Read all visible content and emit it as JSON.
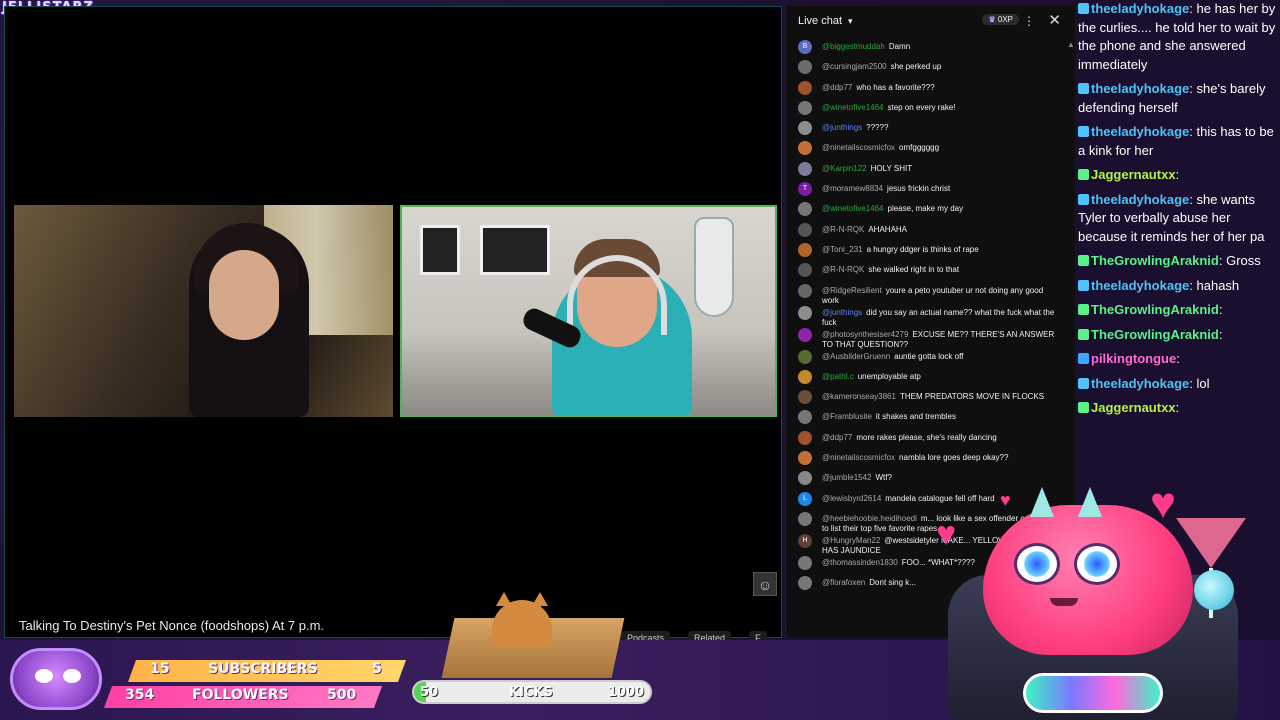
{
  "overlay": {
    "logo": "JELLISTARZ",
    "subscribers": {
      "label": "SUBSCRIBERS",
      "current": "15",
      "goal": "5"
    },
    "followers": {
      "label": "FOLLOWERS",
      "current": "354",
      "goal": "500"
    },
    "kicks": {
      "label": "KICKS",
      "current": "50",
      "goal": "1000",
      "progress": 0.05
    }
  },
  "stream": {
    "title": "Talking To Destiny's Pet Nonce (foodshops) At 7 p.m.",
    "tabs": [
      "Podcasts",
      "Related",
      "F"
    ]
  },
  "live_chat": {
    "header": "Live chat",
    "xp": "0XP",
    "close": "✕",
    "messages": [
      {
        "author": "@biggestmuddah",
        "text": "Damn",
        "avatar_color": "#5c6bc0",
        "avatar_letter": "B",
        "role": "member"
      },
      {
        "author": "@cursingjam2500",
        "text": "she perked up",
        "avatar_color": "#6d6d6d",
        "avatar_letter": "",
        "role": ""
      },
      {
        "author": "@ddp77",
        "text": "who has a favorite???",
        "avatar_color": "#a0522d",
        "avatar_letter": "",
        "role": ""
      },
      {
        "author": "@winetofive1464",
        "text": "step on every rake!",
        "avatar_color": "#777777",
        "avatar_letter": "",
        "role": "member"
      },
      {
        "author": "@junthings",
        "text": "?????",
        "avatar_color": "#8d8d8d",
        "avatar_letter": "",
        "role": "mod"
      },
      {
        "author": "@ninetailscosmicfox",
        "text": "omfgggggg",
        "avatar_color": "#c2703a",
        "avatar_letter": "",
        "role": ""
      },
      {
        "author": "@Karpin122",
        "text": "HOLY SHIT",
        "avatar_color": "#7a7a99",
        "avatar_letter": "",
        "role": "member"
      },
      {
        "author": "@moramew8834",
        "text": "jesus frickin christ",
        "avatar_color": "#7b1fa2",
        "avatar_letter": "T",
        "role": ""
      },
      {
        "author": "@winetofive1464",
        "text": "please, make my day",
        "avatar_color": "#777777",
        "avatar_letter": "",
        "role": "member"
      },
      {
        "author": "@R-N-RQK",
        "text": "AHAHAHA",
        "avatar_color": "#555555",
        "avatar_letter": "",
        "role": ""
      },
      {
        "author": "@Toni_231",
        "text": "a hungry ddger is thinks of rape",
        "avatar_color": "#b0652a",
        "avatar_letter": "",
        "role": ""
      },
      {
        "author": "@R-N-RQK",
        "text": "she walked right in to that",
        "avatar_color": "#555555",
        "avatar_letter": "",
        "role": ""
      },
      {
        "author": "@RidgeResilient",
        "text": "youre a peto youtuber ur not doing any good work",
        "avatar_color": "#666666",
        "avatar_letter": "",
        "role": ""
      },
      {
        "author": "@junthings",
        "text": "did you say an actual name?? what the fuck what the fuck",
        "avatar_color": "#8d8d8d",
        "avatar_letter": "",
        "role": "mod"
      },
      {
        "author": "@photosynthesiser4279",
        "text": "EXCUSE ME?? THERE'S AN ANSWER TO THAT QUESTION??",
        "avatar_color": "#8e24aa",
        "avatar_letter": "",
        "role": ""
      },
      {
        "author": "@AusbilderGruenn",
        "text": "auntie gotta lock off",
        "avatar_color": "#556b2f",
        "avatar_letter": "",
        "role": ""
      },
      {
        "author": "@pathl.c",
        "text": "unemployable atp",
        "avatar_color": "#c48b2a",
        "avatar_letter": "",
        "role": "member"
      },
      {
        "author": "@kameronseay3861",
        "text": "THEM PREDATORS MOVE IN FLOCKS",
        "avatar_color": "#6b4e3a",
        "avatar_letter": "",
        "role": ""
      },
      {
        "author": "@Framblusite",
        "text": "it shakes and trembles",
        "avatar_color": "#777777",
        "avatar_letter": "",
        "role": ""
      },
      {
        "author": "@ddp77",
        "text": "more rakes please, she's really dancing",
        "avatar_color": "#a0522d",
        "avatar_letter": "",
        "role": ""
      },
      {
        "author": "@ninetailscosmicfox",
        "text": "nambla lore goes deep okay??",
        "avatar_color": "#c2703a",
        "avatar_letter": "",
        "role": ""
      },
      {
        "author": "@jumble1542",
        "text": "Wtf?",
        "avatar_color": "#888888",
        "avatar_letter": "",
        "role": ""
      },
      {
        "author": "@lewisbyrd2614",
        "text": "mandela catalogue fell off hard",
        "avatar_color": "#1e88e5",
        "avatar_letter": "L",
        "role": ""
      },
      {
        "author": "@heebiehoobie.heidihoedi",
        "text": "m... look like a sex offender compet... to list their top five favorite rapes",
        "avatar_color": "#777777",
        "avatar_letter": "",
        "role": ""
      },
      {
        "author": "@HungryMan22",
        "text": "@westsidetyler MAKE... YELLOW SKIN, SHE HAS JAUNDICE",
        "avatar_color": "#5d4037",
        "avatar_letter": "H",
        "role": ""
      },
      {
        "author": "@thomassinden1830",
        "text": "FOO... *WHAT*????",
        "avatar_color": "#777777",
        "avatar_letter": "",
        "role": ""
      },
      {
        "author": "@florafoxen",
        "text": "Dont sing k...",
        "avatar_color": "#777777",
        "avatar_letter": "",
        "role": ""
      }
    ]
  },
  "side_chat": [
    {
      "name": "theeladyhokage",
      "text": "he has her by the curlies.... he told her to wait by the phone and she answered immediately",
      "cls": "nm-lady"
    },
    {
      "name": "theeladyhokage",
      "text": "she's barely defending herself",
      "cls": "nm-lady"
    },
    {
      "name": "theeladyhokage",
      "text": "this has to be a kink for her",
      "cls": "nm-lady"
    },
    {
      "name": "Jaggernautxx",
      "text": "",
      "cls": "nm-jag"
    },
    {
      "name": "theeladyhokage",
      "text": "she wants Tyler to verbally abuse her because it reminds her of her pa",
      "cls": "nm-lady"
    },
    {
      "name": "TheGrowlingAraknid",
      "text": "Gross",
      "cls": "nm-growl"
    },
    {
      "name": "theeladyhokage",
      "text": "hahash",
      "cls": "nm-lady"
    },
    {
      "name": "TheGrowlingAraknid",
      "text": "",
      "cls": "nm-growl"
    },
    {
      "name": "TheGrowlingAraknid",
      "text": "",
      "cls": "nm-growl"
    },
    {
      "name": "pilkingtongue",
      "text": "",
      "cls": "nm-pilk"
    },
    {
      "name": "theeladyhokage",
      "text": "lol",
      "cls": "nm-lady"
    },
    {
      "name": "Jaggernautxx",
      "text": "",
      "cls": "nm-jag"
    }
  ]
}
